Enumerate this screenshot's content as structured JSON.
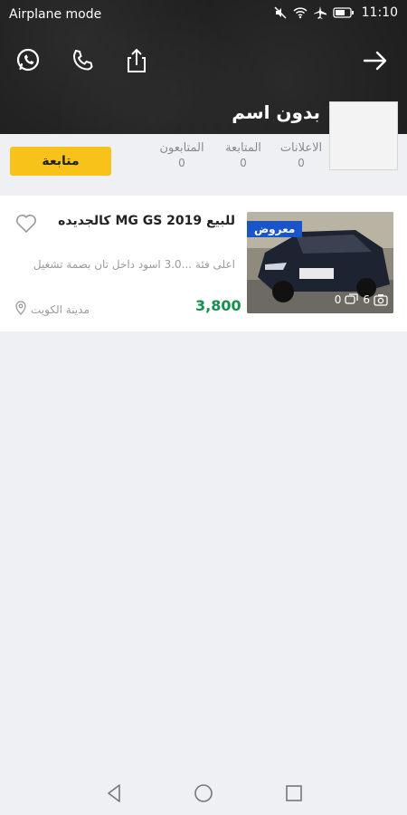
{
  "status_bar": {
    "left_text": "Airplane mode",
    "time": "11:10",
    "icons": [
      "mute-icon",
      "wifi-icon",
      "airplane-icon",
      "battery-icon"
    ]
  },
  "header": {
    "actions": [
      "whatsapp-icon",
      "phone-icon",
      "share-icon",
      "arrow-right-icon"
    ],
    "profile_name": "بدون اسم"
  },
  "stats": {
    "ads_label": "الاعلانات",
    "ads_count": "0",
    "following_label": "المتابعة",
    "following_count": "0",
    "followers_label": "المتابعون",
    "followers_count": "0",
    "follow_button": "متابعة"
  },
  "listing": {
    "badge": "معروض",
    "photo_count": "6",
    "comment_count": "0",
    "title": "للبيع MG GS 2019 كالجديده",
    "description": "اعلى فئة ...3.0  اسود داخل تان بصمة تشغيل",
    "price": "3,800",
    "location": "مدينة الكويت"
  },
  "colors": {
    "accent": "#f7c21a",
    "price": "#178f4e",
    "badge": "#1a54c9"
  }
}
